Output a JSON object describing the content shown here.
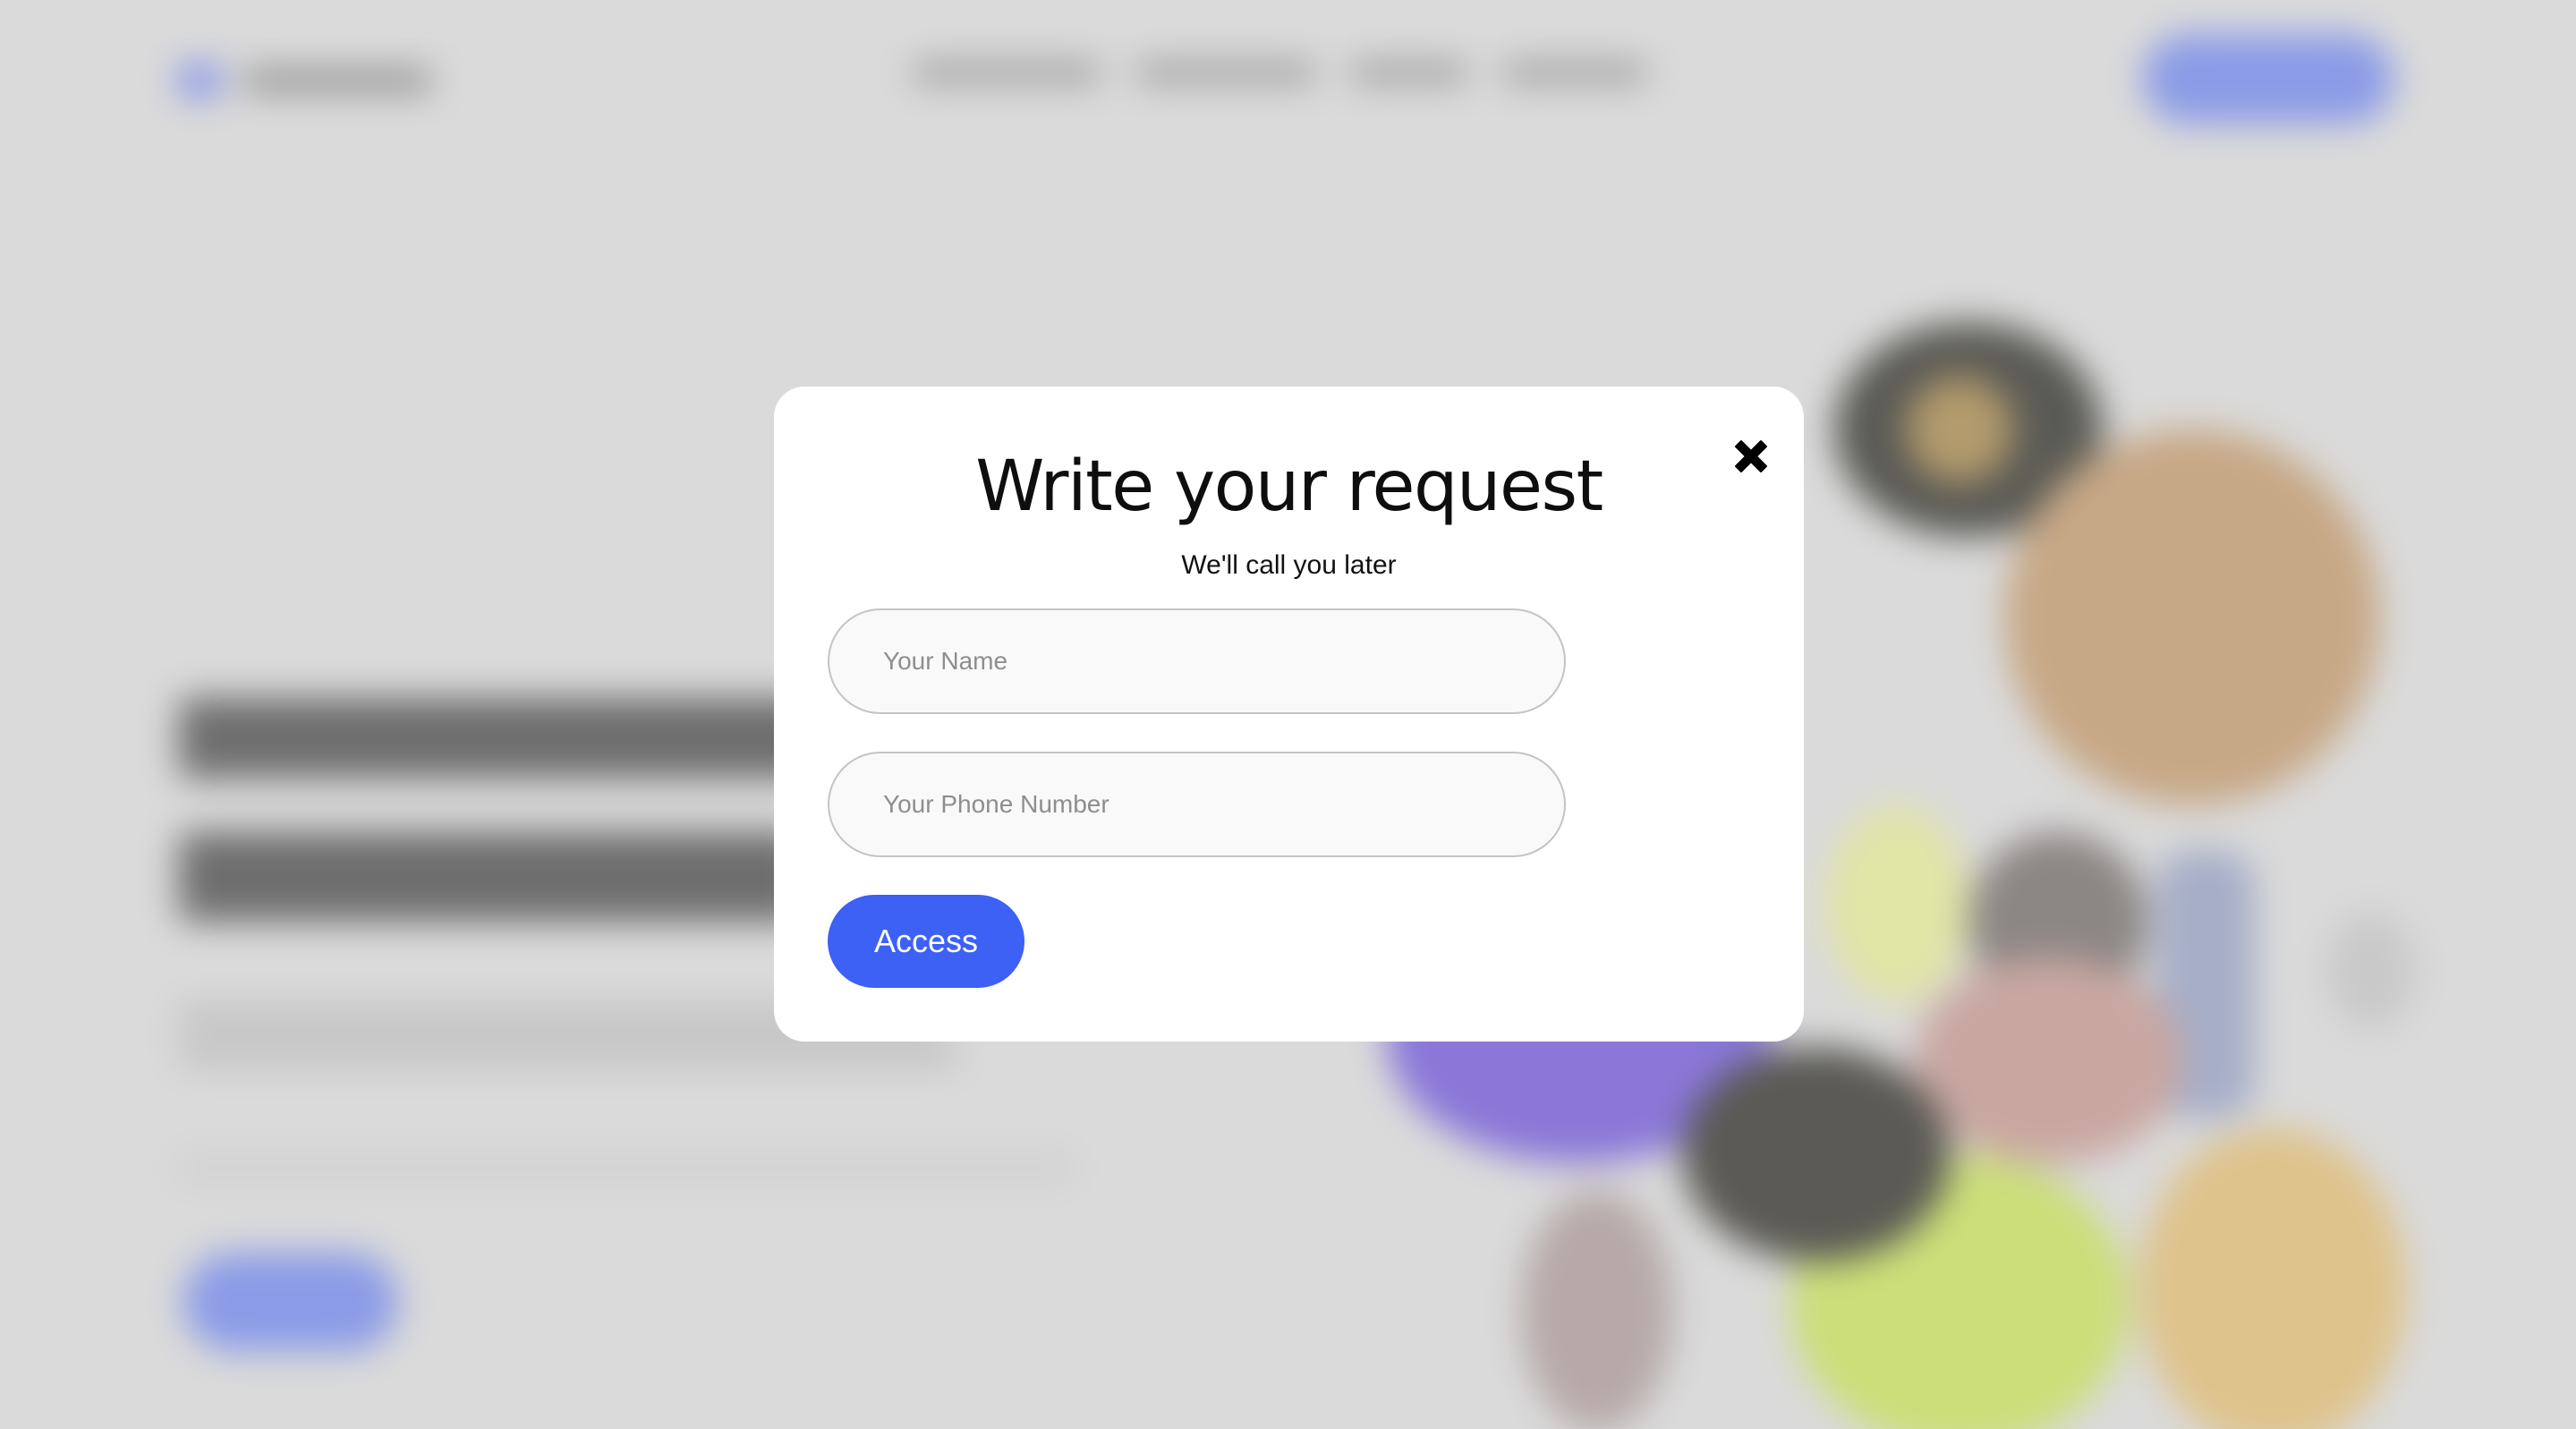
{
  "modal": {
    "title": "Write your request",
    "subtitle": "We'll call you later",
    "name_placeholder": "Your Name",
    "phone_placeholder": "Your Phone Number",
    "submit_label": "Access",
    "close_icon": "close-icon"
  },
  "colors": {
    "overlay_background": "#dadada",
    "modal_background": "#ffffff",
    "accent": "#3d60f5"
  }
}
